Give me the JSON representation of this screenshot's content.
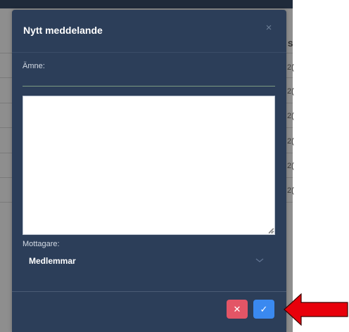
{
  "background": {
    "column_header": "S",
    "row_cells": [
      "2(",
      "2(",
      "2(",
      "2(",
      "2(",
      "2("
    ]
  },
  "modal": {
    "title": "Nytt meddelande",
    "close_glyph": "×",
    "subject": {
      "label": "Ämne:",
      "value": ""
    },
    "message_body": "",
    "recipients": {
      "label": "Mottagare:",
      "selected": "Medlemmar"
    },
    "buttons": {
      "cancel_glyph": "✕",
      "confirm_glyph": "✓"
    }
  },
  "colors": {
    "modal_bg": "#2c3e59",
    "cancel": "#e35566",
    "confirm": "#3a89f0",
    "annotation_arrow": "#e8000b"
  }
}
